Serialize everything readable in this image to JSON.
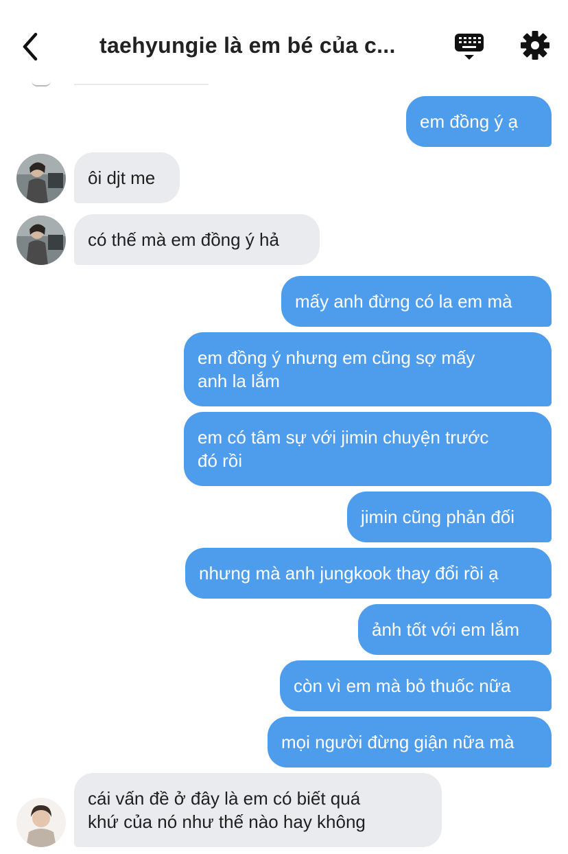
{
  "header": {
    "title": "taehyungie là em bé của c...",
    "back_icon": "chevron-left-icon",
    "keyboard_icon": "keyboard-icon",
    "settings_icon": "gear-icon"
  },
  "colors": {
    "outgoing_bubble": "#4e9ded",
    "incoming_bubble": "#e9ebee",
    "outgoing_text": "#ffffff",
    "incoming_text": "#1f1f1f"
  },
  "messages": [
    {
      "side": "out",
      "text": "em đồng ý ạ"
    },
    {
      "side": "in",
      "text": "ôi djt me"
    },
    {
      "side": "in",
      "text": "có thế mà em đồng ý hả"
    },
    {
      "side": "out",
      "text": "mấy anh đừng có la em mà"
    },
    {
      "side": "out",
      "text": "em đồng ý nhưng em cũng sợ mấy\nanh la lắm"
    },
    {
      "side": "out",
      "text": "em có tâm sự với jimin chuyện trước\nđó rồi"
    },
    {
      "side": "out",
      "text": "jimin cũng phản đối"
    },
    {
      "side": "out",
      "text": "nhưng mà anh jungkook thay đổi rồi ạ"
    },
    {
      "side": "out",
      "text": "ảnh tốt với em lắm"
    },
    {
      "side": "out",
      "text": "còn vì em mà bỏ thuốc nữa"
    },
    {
      "side": "out",
      "text": "mọi người đừng giận nữa mà"
    },
    {
      "side": "in",
      "text": "cái vấn đề ở đây là em có biết quá\nkhứ của nó như thế nào hay không"
    }
  ]
}
